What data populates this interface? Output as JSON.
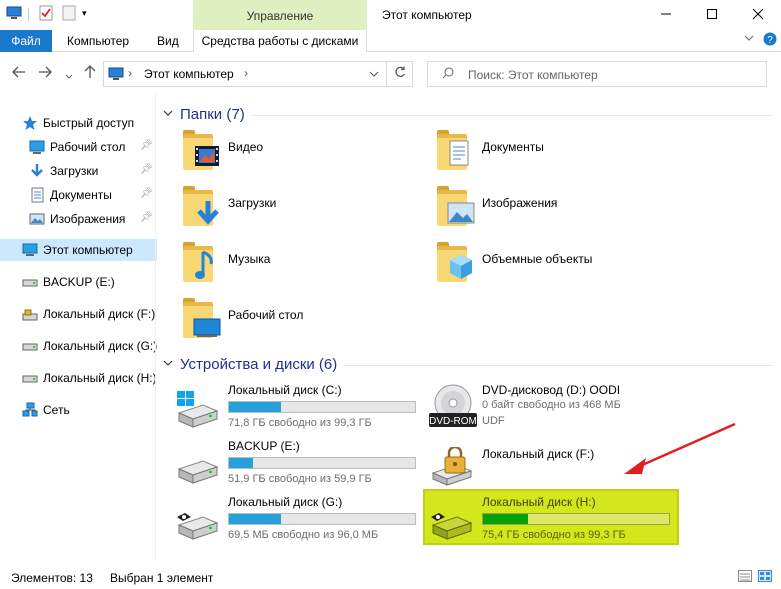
{
  "window": {
    "title": "Этот компьютер",
    "manage_tab": "Управление",
    "min_icon": "minimize-icon",
    "max_icon": "maximize-icon",
    "close_icon": "close-icon"
  },
  "ribbon": {
    "tabs": [
      "Файл",
      "Компьютер",
      "Вид",
      "Средства работы с дисками"
    ]
  },
  "address": {
    "path": "Этот компьютер",
    "search_placeholder": "Поиск: Этот компьютер"
  },
  "sidebar": {
    "items": [
      {
        "label": "Быстрый доступ",
        "icon": "star-icon",
        "pinned": false
      },
      {
        "label": "Рабочий стол",
        "icon": "desktop-folder-icon",
        "pinned": true
      },
      {
        "label": "Загрузки",
        "icon": "download-icon",
        "pinned": true
      },
      {
        "label": "Документы",
        "icon": "documents-icon",
        "pinned": true
      },
      {
        "label": "Изображения",
        "icon": "pictures-icon",
        "pinned": true
      },
      {
        "label": "Этот компьютер",
        "icon": "computer-icon",
        "selected": true
      },
      {
        "label": "BACKUP (E:)",
        "icon": "drive-icon"
      },
      {
        "label": "Локальный диск (F:)",
        "icon": "locked-drive-icon"
      },
      {
        "label": "Локальный диск (G:)",
        "icon": "drive-icon"
      },
      {
        "label": "Локальный диск (H:)",
        "icon": "drive-icon"
      },
      {
        "label": "Сеть",
        "icon": "network-icon"
      }
    ]
  },
  "main": {
    "folders_header": "Папки (7)",
    "drives_header": "Устройства и диски (6)",
    "folders": [
      {
        "name": "Видео",
        "icon": "video-folder-icon"
      },
      {
        "name": "Документы",
        "icon": "documents-folder-icon"
      },
      {
        "name": "Загрузки",
        "icon": "downloads-folder-icon"
      },
      {
        "name": "Изображения",
        "icon": "pictures-folder-icon"
      },
      {
        "name": "Музыка",
        "icon": "music-folder-icon"
      },
      {
        "name": "Объемные объекты",
        "icon": "3d-objects-folder-icon"
      },
      {
        "name": "Рабочий стол",
        "icon": "desktop-folder-icon"
      }
    ],
    "drives": [
      {
        "name": "Локальный диск (C:)",
        "info": "71,8 ГБ свободно из 99,3 ГБ",
        "used_fraction": 0.28,
        "icon": "windows-drive-icon"
      },
      {
        "name": "DVD-дисковод (D:) OODI",
        "info": "0 байт свободно из 468 МБ",
        "info2": "UDF",
        "icon": "dvd-rom-icon",
        "badge": "DVD-ROM"
      },
      {
        "name": "BACKUP (E:)",
        "info": "51,9 ГБ свободно из 59,9 ГБ",
        "used_fraction": 0.13,
        "icon": "drive-icon"
      },
      {
        "name": "Локальный диск (F:)",
        "icon": "locked-drive-icon"
      },
      {
        "name": "Локальный диск (G:)",
        "info": "69,5 МБ свободно из 96,0 МБ",
        "used_fraction": 0.28,
        "icon": "drive-icon"
      },
      {
        "name": "Локальный диск (H:)",
        "info": "75,4 ГБ свободно из 99,3 ГБ",
        "used_fraction": 0.24,
        "icon": "drive-icon",
        "highlighted": true
      }
    ]
  },
  "status": {
    "items_count": "Элементов: 13",
    "selected": "Выбран 1 элемент"
  },
  "colors": {
    "accent": "#1979ca",
    "progress": "#26a0da",
    "highlight": "#d4e71c",
    "arrow": "#e02020",
    "manage": "#dff0c0"
  }
}
